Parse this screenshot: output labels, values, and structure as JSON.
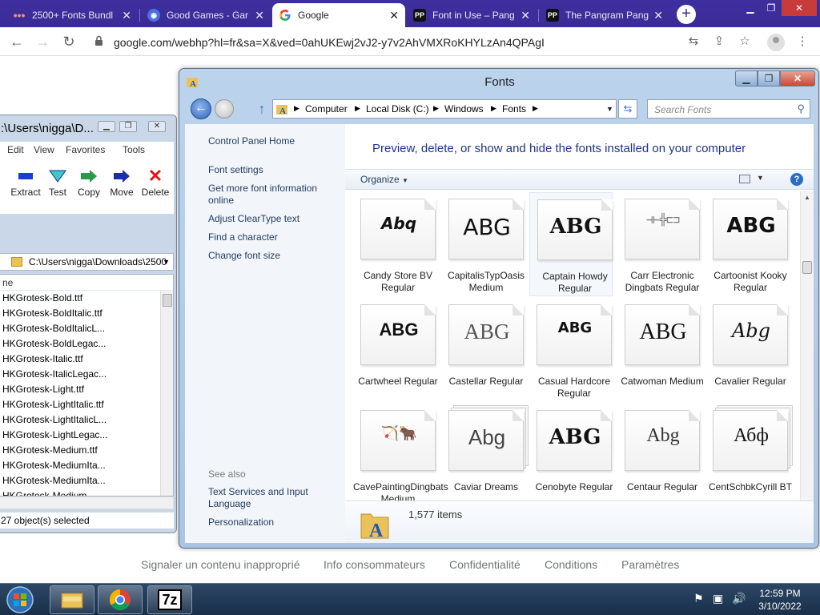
{
  "browser": {
    "tabs": [
      {
        "title": "2500+ Fonts Bundl",
        "icon": "dots-icon",
        "active": false
      },
      {
        "title": "Good Games - Gar",
        "icon": "gamepad-icon",
        "active": false
      },
      {
        "title": "Google",
        "icon": "google-g-icon",
        "active": true
      },
      {
        "title": "Font in Use – Pang",
        "icon": "pp-icon",
        "active": false
      },
      {
        "title": "The Pangram Pang",
        "icon": "pp-icon",
        "active": false
      }
    ],
    "new_tab": "+",
    "url": "google.com/webhp?hl=fr&sa=X&ved=0ahUKEwj2vJ2-y7v2AhVMXRoKHYLzAn4QPAgI"
  },
  "google_footer": {
    "links": [
      "Signaler un contenu inapproprié",
      "Info consommateurs",
      "Confidentialité",
      "Conditions",
      "Paramètres"
    ]
  },
  "zip": {
    "title": ":\\Users\\nigga\\D...",
    "menu": [
      "Edit",
      "View",
      "Favorites",
      "Tools"
    ],
    "tools": [
      {
        "label": "Extract",
        "icon": "extract-icon"
      },
      {
        "label": "Test",
        "icon": "test-icon"
      },
      {
        "label": "Copy",
        "icon": "copy-icon"
      },
      {
        "label": "Move",
        "icon": "move-icon"
      },
      {
        "label": "Delete",
        "icon": "delete-icon"
      }
    ],
    "path": "C:\\Users\\nigga\\Downloads\\2500",
    "column": "ne",
    "files": [
      "HKGrotesk-Bold.ttf",
      "HKGrotesk-BoldItalic.ttf",
      "HKGrotesk-BoldItalicL...",
      "HKGrotesk-BoldLegac...",
      "HKGrotesk-Italic.ttf",
      "HKGrotesk-ItalicLegac...",
      "HKGrotesk-Light.ttf",
      "HKGrotesk-LightItalic.ttf",
      "HKGrotesk-LightItalicL...",
      "HKGrotesk-LightLegac...",
      "HKGrotesk-Medium.ttf",
      "HKGrotesk-MediumIta...",
      "HKGrotesk-MediumIta...",
      "HKGrotesk-Medium..."
    ],
    "status": "27 object(s) selected"
  },
  "fonts": {
    "title": "Fonts",
    "breadcrumb": [
      "Computer",
      "Local Disk (C:)",
      "Windows",
      "Fonts"
    ],
    "search_placeholder": "Search Fonts",
    "left_links": [
      "Control Panel Home",
      "Font settings",
      "Get more font information online",
      "Adjust ClearType text",
      "Find a character",
      "Change font size"
    ],
    "see_also_label": "See also",
    "see_also": [
      "Text Services and Input Language",
      "Personalization"
    ],
    "heading": "Preview, delete, or show and hide the fonts installed on your computer",
    "organize": "Organize",
    "tiles": [
      {
        "name": "Candy Store BV Regular",
        "sample": "Abq",
        "stacked": false
      },
      {
        "name": "CapitalisTypOasis Medium",
        "sample": "ABG",
        "stacked": false
      },
      {
        "name": "Captain Howdy Regular",
        "sample": "ABG",
        "stacked": false
      },
      {
        "name": "Carr Electronic Dingbats Regular",
        "sample": "⊣⊢╬⊏⊐",
        "stacked": false
      },
      {
        "name": "Cartoonist Kooky Regular",
        "sample": "ABG",
        "stacked": false
      },
      {
        "name": "Cartwheel Regular",
        "sample": "ABG",
        "stacked": false
      },
      {
        "name": "Castellar Regular",
        "sample": "ABG",
        "stacked": false
      },
      {
        "name": "Casual Hardcore Regular",
        "sample": "ABG",
        "stacked": false
      },
      {
        "name": "Catwoman Medium",
        "sample": "ABG",
        "stacked": false
      },
      {
        "name": "Cavalier Regular",
        "sample": "Abg",
        "stacked": false
      },
      {
        "name": "CavePaintingDingbats Medium",
        "sample": "🏹🐂",
        "stacked": false
      },
      {
        "name": "Caviar Dreams",
        "sample": "Abg",
        "stacked": true
      },
      {
        "name": "Cenobyte Regular",
        "sample": "ABG",
        "stacked": false
      },
      {
        "name": "Centaur Regular",
        "sample": "Abg",
        "stacked": false
      },
      {
        "name": "CentSchbkCyrill BT",
        "sample": "Абф",
        "stacked": true
      }
    ],
    "item_count": "1,577 items"
  },
  "taskbar": {
    "time": "12:59 PM",
    "date": "3/10/2022",
    "apps": [
      "explorer-icon",
      "chrome-icon",
      "7zip-icon"
    ],
    "zip_label": "7z"
  }
}
